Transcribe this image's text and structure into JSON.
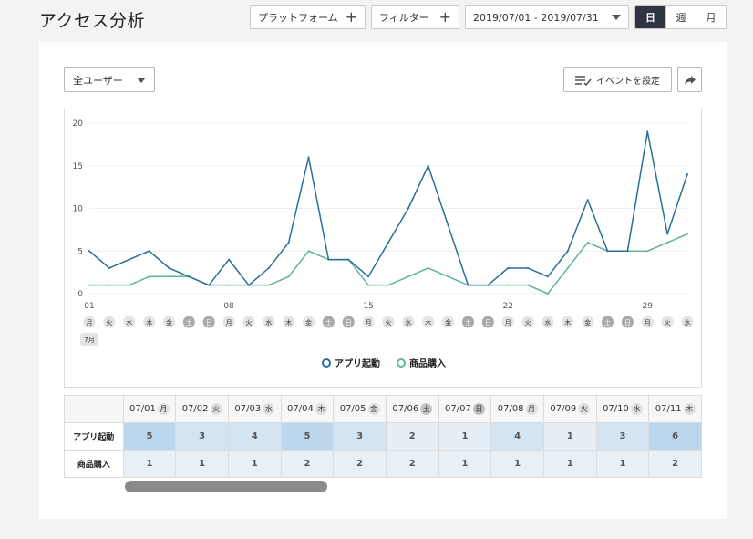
{
  "page": {
    "title": "アクセス分析"
  },
  "toolbar": {
    "platform_label": "プラットフォーム",
    "filter_label": "フィルター",
    "date_range": "2019/07/01 - 2019/07/31",
    "granularity": [
      {
        "label": "日",
        "active": true
      },
      {
        "label": "週",
        "active": false
      },
      {
        "label": "月",
        "active": false
      }
    ]
  },
  "controls": {
    "user_segment": "全ユーザー",
    "event_button_label": "イベントを設定"
  },
  "chart_data": {
    "type": "line",
    "x": [
      "07/01",
      "07/02",
      "07/03",
      "07/04",
      "07/05",
      "07/06",
      "07/07",
      "07/08",
      "07/09",
      "07/10",
      "07/11",
      "07/12",
      "07/13",
      "07/14",
      "07/15",
      "07/16",
      "07/17",
      "07/18",
      "07/19",
      "07/20",
      "07/21",
      "07/22",
      "07/23",
      "07/24",
      "07/25",
      "07/26",
      "07/27",
      "07/28",
      "07/29",
      "07/30",
      "07/31"
    ],
    "series": [
      {
        "name": "アプリ起動",
        "color": "#2a6f97",
        "values": [
          5,
          3,
          4,
          5,
          3,
          2,
          1,
          4,
          1,
          3,
          6,
          16,
          4,
          4,
          2,
          6,
          10,
          15,
          8,
          1,
          1,
          3,
          3,
          2,
          5,
          11,
          5,
          5,
          19,
          7,
          14
        ]
      },
      {
        "name": "商品購入",
        "color": "#5fb3a1",
        "values": [
          1,
          1,
          1,
          2,
          2,
          2,
          1,
          1,
          1,
          1,
          2,
          5,
          4,
          4,
          1,
          1,
          2,
          3,
          2,
          1,
          1,
          1,
          1,
          0,
          3,
          6,
          5,
          5,
          5,
          6,
          7
        ]
      }
    ],
    "ylim": [
      0,
      20
    ],
    "yticks": [
      0,
      5,
      10,
      15,
      20
    ],
    "xtick_labels": [
      {
        "index": 0,
        "label": "01"
      },
      {
        "index": 7,
        "label": "08"
      },
      {
        "index": 14,
        "label": "15"
      },
      {
        "index": 21,
        "label": "22"
      },
      {
        "index": 28,
        "label": "29"
      }
    ],
    "weekdays": [
      "月",
      "火",
      "水",
      "木",
      "金",
      "土",
      "日",
      "月",
      "火",
      "水",
      "木",
      "金",
      "土",
      "日",
      "月",
      "火",
      "水",
      "木",
      "金",
      "土",
      "日",
      "月",
      "火",
      "水",
      "木",
      "金",
      "土",
      "日",
      "月",
      "火",
      "水"
    ],
    "month_label": "7月",
    "grid": true,
    "legend_position": "bottom-center"
  },
  "table": {
    "columns": [
      {
        "date": "07/01",
        "wd": "月"
      },
      {
        "date": "07/02",
        "wd": "火"
      },
      {
        "date": "07/03",
        "wd": "水"
      },
      {
        "date": "07/04",
        "wd": "木"
      },
      {
        "date": "07/05",
        "wd": "金"
      },
      {
        "date": "07/06",
        "wd": "土"
      },
      {
        "date": "07/07",
        "wd": "日"
      },
      {
        "date": "07/08",
        "wd": "月"
      },
      {
        "date": "07/09",
        "wd": "火"
      },
      {
        "date": "07/10",
        "wd": "水"
      },
      {
        "date": "07/11",
        "wd": "木"
      }
    ],
    "rows": [
      {
        "label": "アプリ起動",
        "values": [
          5,
          3,
          4,
          5,
          3,
          2,
          1,
          4,
          1,
          3,
          6
        ]
      },
      {
        "label": "商品購入",
        "values": [
          1,
          1,
          1,
          2,
          2,
          2,
          1,
          1,
          1,
          1,
          2
        ]
      }
    ]
  }
}
